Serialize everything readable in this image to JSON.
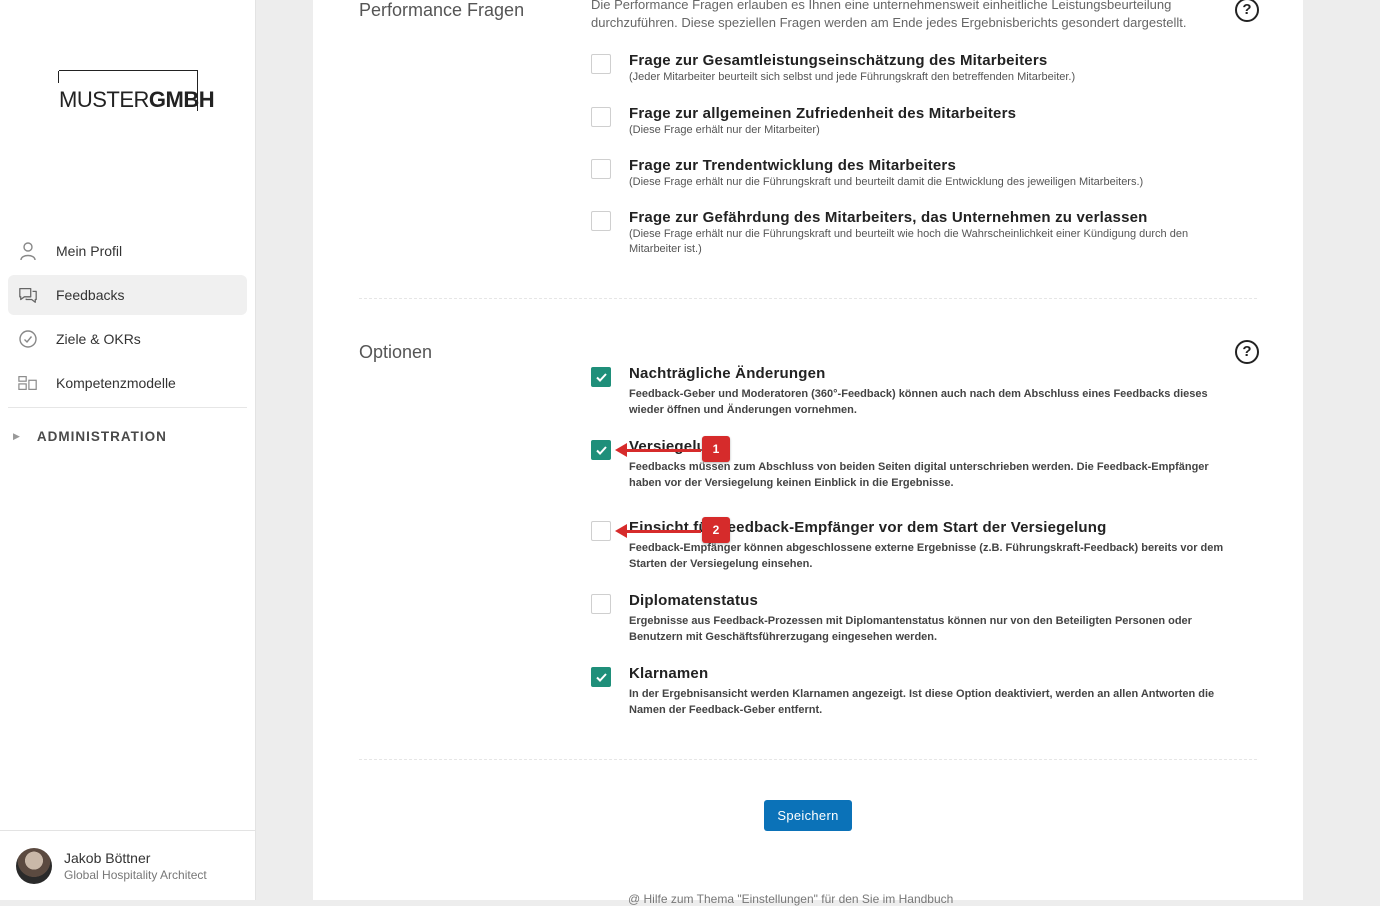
{
  "sidebar": {
    "logo": {
      "part1": "MUSTER",
      "part2": "GMBH"
    },
    "items": [
      {
        "label": "Mein Profil",
        "icon": "user-icon"
      },
      {
        "label": "Feedbacks",
        "icon": "chat-icon",
        "active": true
      },
      {
        "label": "Ziele & OKRs",
        "icon": "check-circle-icon"
      },
      {
        "label": "Kompetenzmodelle",
        "icon": "grid-icon"
      }
    ],
    "admin_label": "ADMINISTRATION",
    "user": {
      "name": "Jakob Böttner",
      "role": "Global Hospitality Architect"
    }
  },
  "performance": {
    "title": "Performance Fragen",
    "intro": "Die Performance Fragen erlauben es Ihnen eine unternehmensweit einheitliche Leistungsbeurteilung durchzuführen. Diese speziellen Fragen werden am Ende jedes Ergebnisberichts gesondert dargestellt.",
    "items": [
      {
        "title": "Frage zur Gesamtleistungseinschätzung des Mitarbeiters",
        "desc": "(Jeder Mitarbeiter beurteilt sich selbst und jede Führungskraft den betreffenden Mitarbeiter.)",
        "checked": false
      },
      {
        "title": "Frage zur allgemeinen Zufriedenheit des Mitarbeiters",
        "desc": "(Diese Frage erhält nur der Mitarbeiter)",
        "checked": false
      },
      {
        "title": "Frage zur Trendentwicklung des Mitarbeiters",
        "desc": "(Diese Frage erhält nur die Führungskraft und beurteilt damit die Entwicklung des jeweiligen Mitarbeiters.)",
        "checked": false
      },
      {
        "title": "Frage zur Gefährdung des Mitarbeiters, das Unternehmen zu verlassen",
        "desc": "(Diese Frage erhält nur die Führungskraft und beurteilt wie hoch die Wahrscheinlichkeit einer Kündigung durch den Mitarbeiter ist.)",
        "checked": false
      }
    ]
  },
  "options": {
    "title": "Optionen",
    "items": [
      {
        "title": "Nachträgliche Änderungen",
        "desc": "Feedback-Geber und Moderatoren (360°-Feedback) können auch nach dem Abschluss eines Feedbacks dieses wieder öffnen und Änderungen vornehmen.",
        "checked": true
      },
      {
        "title": "Versiegelung",
        "desc": "Feedbacks müssen zum Abschluss von beiden Seiten digital unterschrieben werden. Die Feedback-Empfänger haben vor der Versiegelung keinen Einblick in die Ergebnisse.",
        "checked": true
      },
      {
        "title": "Einsicht für Feedback-Empfänger vor dem Start der Versiegelung",
        "desc": "Feedback-Empfänger können abgeschlossene externe Ergebnisse (z.B. Führungskraft-Feedback) bereits vor dem Starten der Versiegelung einsehen.",
        "checked": false
      },
      {
        "title": "Diplomatenstatus",
        "desc": "Ergebnisse aus Feedback-Prozessen mit Diplomantenstatus können nur von den Beteiligten Personen oder Benutzern mit Geschäftsführerzugang eingesehen werden.",
        "checked": false
      },
      {
        "title": "Klarnamen",
        "desc": "In der Ergebnisansicht werden Klarnamen angezeigt. Ist diese Option deaktiviert, werden an allen Antworten die Namen der Feedback-Geber entfernt.",
        "checked": true
      }
    ]
  },
  "help_glyph": "?",
  "save_label": "Speichern",
  "footer_hint": "@ Hilfe zum Thema \"Einstellungen\" für den Sie im Handbuch",
  "markers": [
    "1",
    "2"
  ],
  "colors": {
    "accent": "#1f8f7a",
    "button": "#0b72b8",
    "marker": "#d62b2b"
  }
}
